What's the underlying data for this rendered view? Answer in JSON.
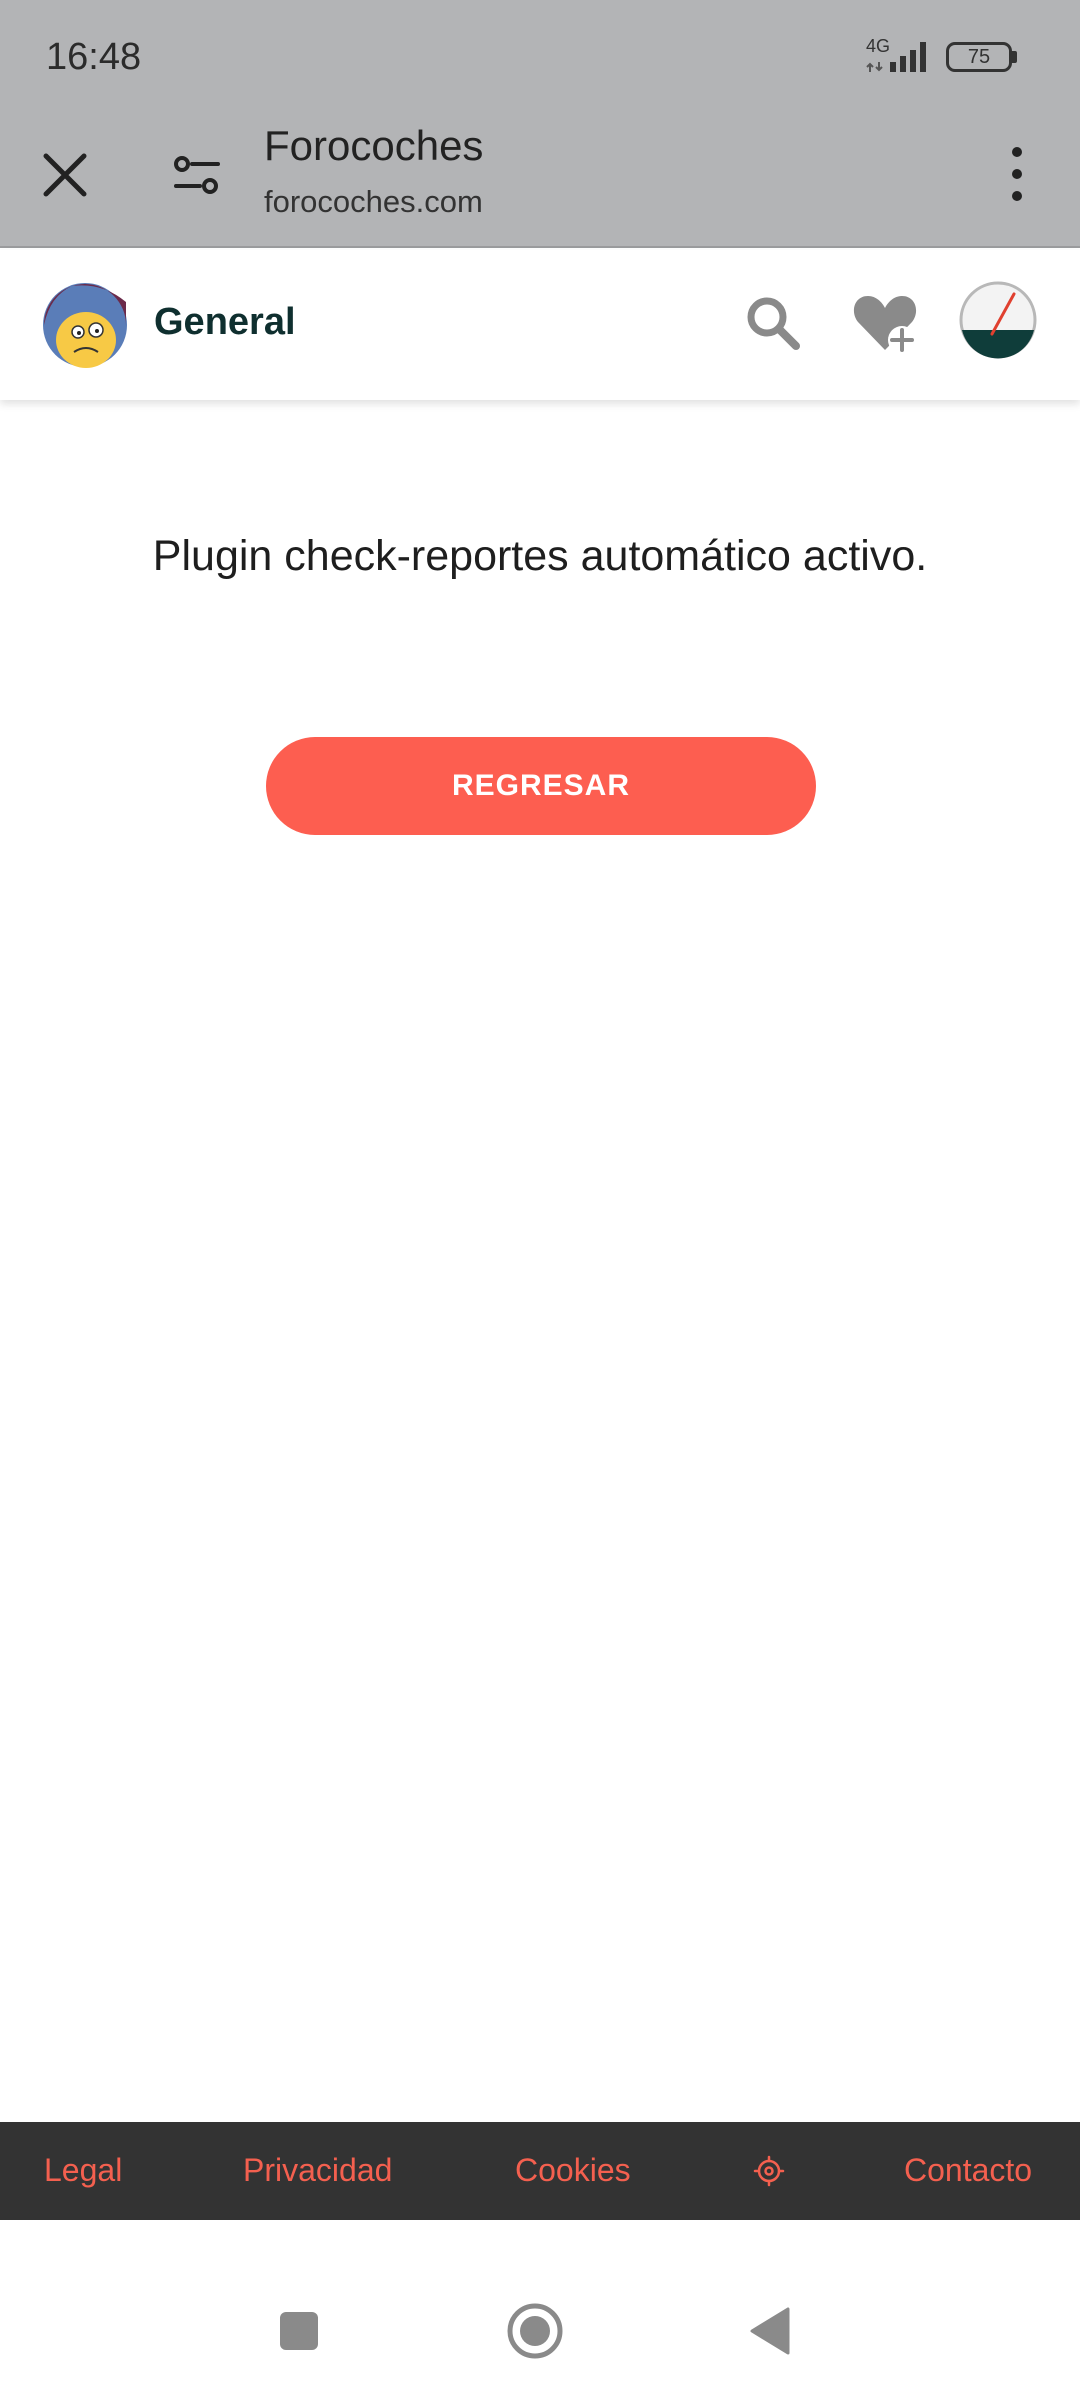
{
  "status_bar": {
    "time": "16:48",
    "network": "4G",
    "battery": "75"
  },
  "browser": {
    "title": "Forocoches",
    "url": "forocoches.com"
  },
  "app_header": {
    "forum_name": "General"
  },
  "main": {
    "message": "Plugin check-reportes automático activo.",
    "back_button_label": "REGRESAR"
  },
  "footer": {
    "links": [
      "Legal",
      "Privacidad",
      "Cookies",
      "Contacto"
    ]
  },
  "colors": {
    "accent": "#fd5e50",
    "footer_bg": "#333333",
    "footer_link": "#f4604f",
    "browser_bar": "#b3b4b6"
  },
  "icons": {
    "close": "close-icon",
    "site_settings": "tune-icon",
    "more": "more-vert-icon",
    "search": "search-icon",
    "favorite": "heart-plus-icon",
    "gauge": "gauge-icon",
    "settings": "gear-icon",
    "nav_recents": "square-icon",
    "nav_home": "circle-icon",
    "nav_back": "triangle-back-icon"
  }
}
